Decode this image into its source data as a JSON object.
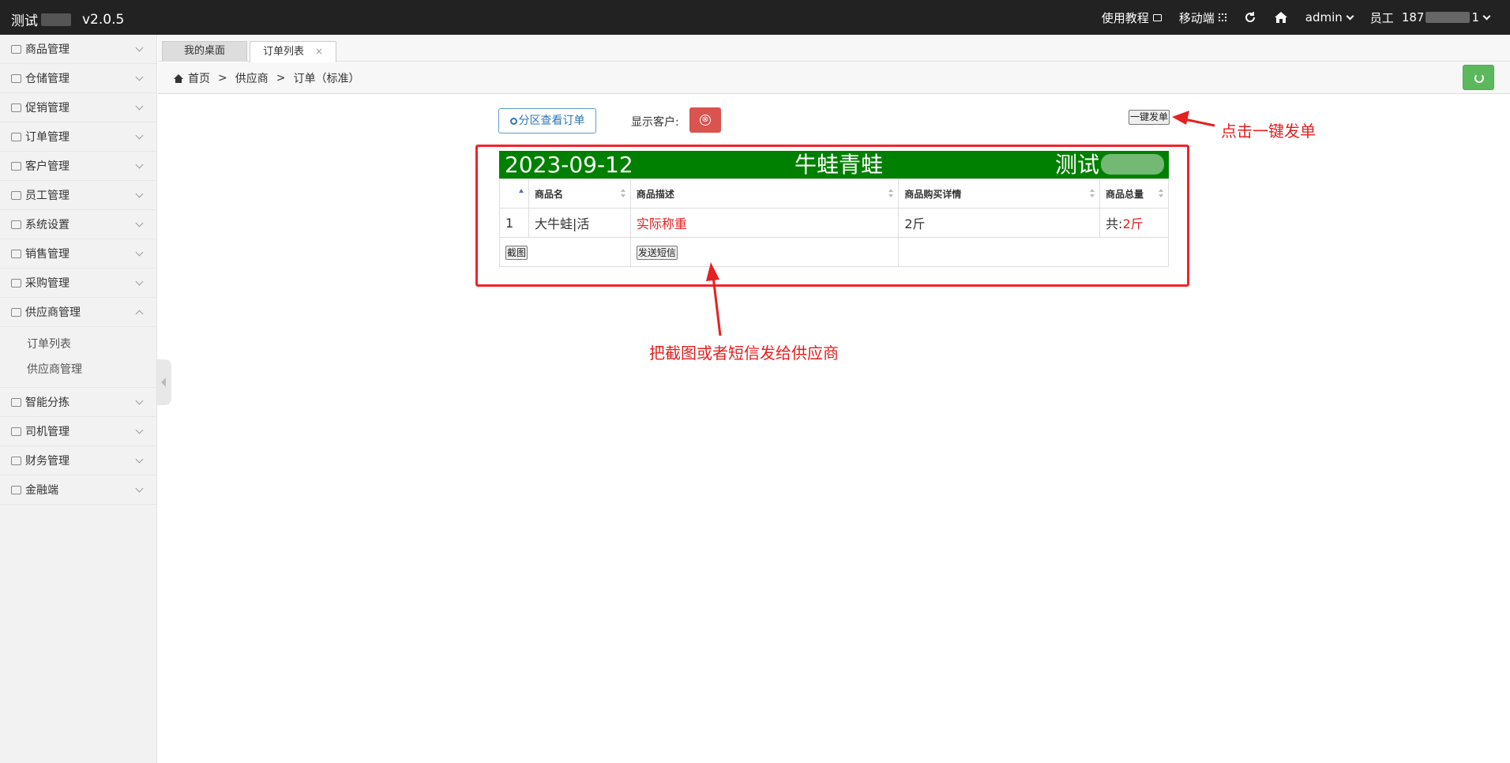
{
  "topbar": {
    "app_name": "测试",
    "version": "v2.0.5",
    "tutorial": "使用教程",
    "mobile": "移动端",
    "user": "admin",
    "role": "员工",
    "phone_prefix": "187",
    "phone_suffix": "1"
  },
  "sidebar": {
    "items": [
      {
        "label": "商品管理",
        "icon": "bag-icon"
      },
      {
        "label": "仓储管理",
        "icon": "truck-icon"
      },
      {
        "label": "促销管理",
        "icon": "book-icon"
      },
      {
        "label": "订单管理",
        "icon": "order-icon"
      },
      {
        "label": "客户管理",
        "icon": "card-icon"
      },
      {
        "label": "员工管理",
        "icon": "user-icon"
      },
      {
        "label": "系统设置",
        "icon": "tools-icon"
      },
      {
        "label": "销售管理",
        "icon": "fire-icon"
      },
      {
        "label": "采购管理",
        "icon": "circle-user-icon"
      },
      {
        "label": "供应商管理",
        "icon": "supplier-icon",
        "expanded": true
      },
      {
        "label": "智能分拣",
        "icon": "grid-icon"
      },
      {
        "label": "司机管理",
        "icon": "truck-icon"
      },
      {
        "label": "财务管理",
        "icon": "bank-icon"
      },
      {
        "label": "金融端",
        "icon": "bank-icon"
      }
    ],
    "submenu": [
      "订单列表",
      "供应商管理"
    ]
  },
  "tabs": [
    {
      "label": "我的桌面"
    },
    {
      "label": "订单列表",
      "close": "×"
    }
  ],
  "breadcrumb": {
    "home": "首页",
    "sep": ">",
    "level2": "供应商",
    "level3": "订单（标准）"
  },
  "controls": {
    "area_button": "分区查看订单",
    "show_customer_label": "显示客户:",
    "toggle_symbol": "⊗",
    "send_all_button": "一键发单"
  },
  "order": {
    "date": "2023-09-12",
    "supplier": "牛蛙青蛙",
    "customer": "测试",
    "header_color": "#008000",
    "columns": [
      "商品名",
      "商品描述",
      "商品购买详情",
      "商品总量"
    ],
    "rows": [
      {
        "index": "1",
        "name": "大牛蛙|活",
        "desc": "实际称重",
        "detail": "2斤",
        "total_prefix": "共:",
        "total_value": "2斤"
      }
    ],
    "screenshot_button": "截图",
    "sms_button": "发送短信"
  },
  "annotations": {
    "send_all_hint": "点击一键发单",
    "send_hint": "把截图或者短信发给供应商",
    "color": "#e52020"
  }
}
